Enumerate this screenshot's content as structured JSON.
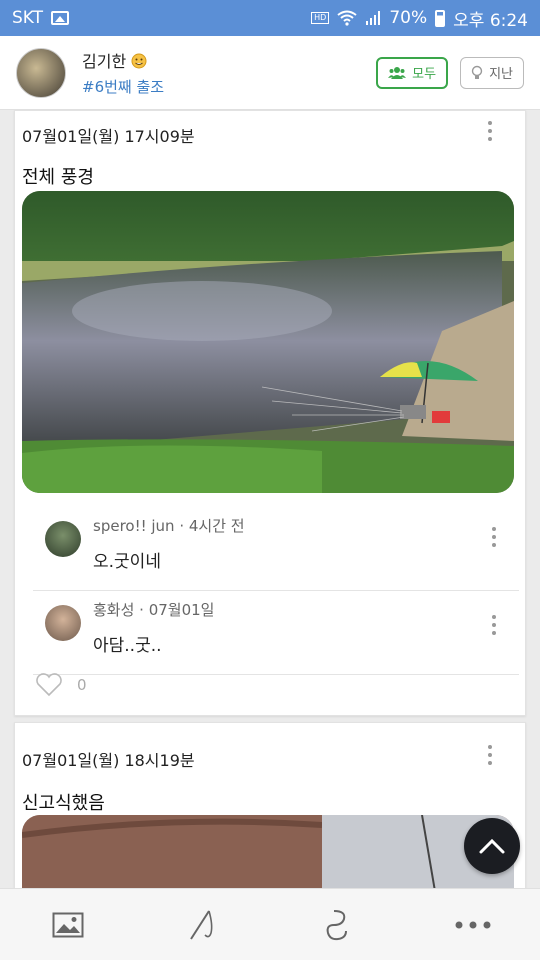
{
  "status": {
    "carrier": "SKT",
    "hd_label": "HD\nVoice",
    "battery": "70%",
    "time": "오후 6:24"
  },
  "header": {
    "name": "김기한",
    "tag": "#6번째 출조",
    "btn_all": "모두",
    "btn_past": "지난"
  },
  "posts": [
    {
      "date": "07월01일(월) 17시09분",
      "title": "전체 풍경",
      "comments": [
        {
          "author": "spero!! jun · 4시간 전",
          "text": "오.굿이네"
        },
        {
          "author": "홍화성 · 07월01일",
          "text": "아담..굿.."
        }
      ],
      "likes": "0"
    },
    {
      "date": "07월01일(월) 18시19분",
      "title": "신고식했음"
    }
  ],
  "colors": {
    "statusbar": "#5b8fd6",
    "accent_green": "#3aa64a",
    "tag_blue": "#3c7dc4",
    "fab": "#1b1d22"
  },
  "icons": [
    "image-icon",
    "rod-icon",
    "hook-icon",
    "more-icon",
    "chevron-up-icon",
    "heart-icon",
    "people-icon",
    "bulb-icon"
  ]
}
